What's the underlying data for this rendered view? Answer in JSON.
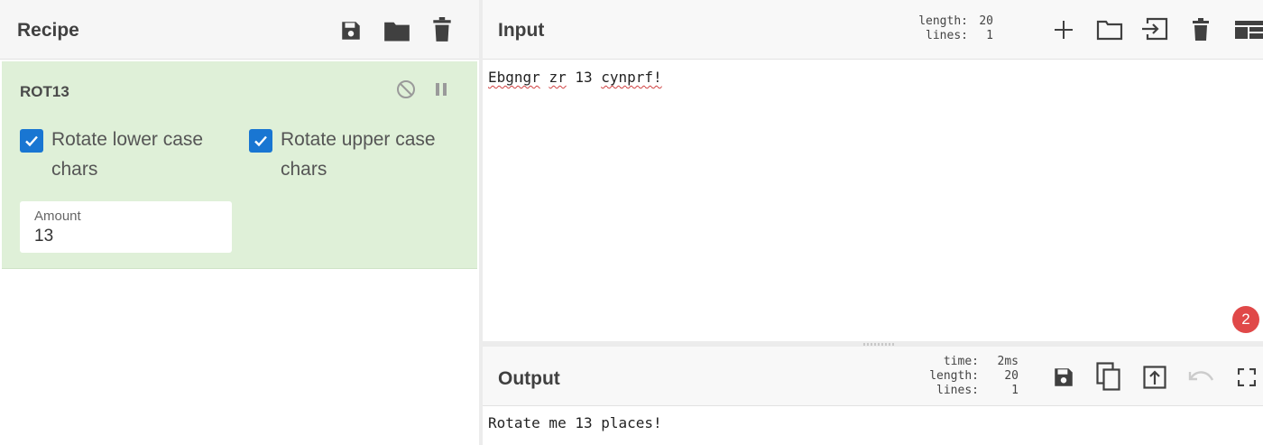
{
  "recipe": {
    "title": "Recipe",
    "toolbar": [
      {
        "name": "save-recipe-button",
        "icon": "save-icon"
      },
      {
        "name": "load-recipe-button",
        "icon": "folder-icon"
      },
      {
        "name": "clear-recipe-button",
        "icon": "trash-icon"
      }
    ],
    "operation": {
      "name": "ROT13",
      "disable_icon": "disable-icon",
      "pause_icon": "pause-icon",
      "options": [
        {
          "label": "Rotate lower case chars",
          "checked": true
        },
        {
          "label": "Rotate upper case chars",
          "checked": true
        }
      ],
      "amount": {
        "label": "Amount",
        "value": "13"
      }
    }
  },
  "input": {
    "title": "Input",
    "stats": {
      "length_label": "length:",
      "length": "20",
      "lines_label": "lines:",
      "lines": "1"
    },
    "text_words": [
      "Ebgngr",
      "zr",
      "13",
      "cynprf!"
    ],
    "toolbar": [
      {
        "name": "add-input-button",
        "icon": "plus-icon"
      },
      {
        "name": "open-file-button",
        "icon": "folder-icon"
      },
      {
        "name": "open-folder-button",
        "icon": "import-icon"
      },
      {
        "name": "clear-input-button",
        "icon": "trash-icon"
      },
      {
        "name": "reset-layout-button",
        "icon": "layout-icon"
      }
    ]
  },
  "output": {
    "title": "Output",
    "stats": {
      "time_label": "time:",
      "time": "2ms",
      "length_label": "length:",
      "length": "20",
      "lines_label": "lines:",
      "lines": "1"
    },
    "text": "Rotate me 13 places!",
    "toolbar": [
      {
        "name": "save-output-button",
        "icon": "save-icon"
      },
      {
        "name": "copy-output-button",
        "icon": "copy-icon"
      },
      {
        "name": "replace-input-button",
        "icon": "move-to-input-icon"
      },
      {
        "name": "undo-button",
        "icon": "undo-icon"
      },
      {
        "name": "maximise-output-button",
        "icon": "fullscreen-icon"
      }
    ]
  },
  "notification": {
    "count": "2",
    "color": "#e04848"
  },
  "colors": {
    "operation_bg": "#dff0d8",
    "checkbox": "#1976d2",
    "icon": "#404040"
  }
}
